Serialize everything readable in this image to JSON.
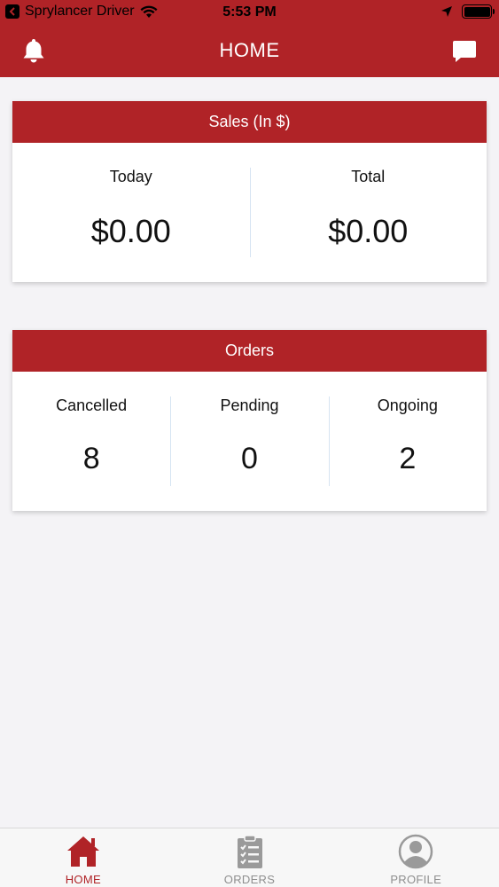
{
  "status_bar": {
    "carrier": "Sprylancer Driver",
    "time": "5:53 PM"
  },
  "header": {
    "title": "HOME",
    "left_icon": "bell-icon",
    "right_icon": "chat-icon"
  },
  "sales": {
    "title": "Sales (In $)",
    "today_label": "Today",
    "today_value": "$0.00",
    "total_label": "Total",
    "total_value": "$0.00"
  },
  "orders": {
    "title": "Orders",
    "cancelled_label": "Cancelled",
    "cancelled_value": "8",
    "pending_label": "Pending",
    "pending_value": "0",
    "ongoing_label": "Ongoing",
    "ongoing_value": "2"
  },
  "tabs": [
    {
      "label": "HOME",
      "icon": "home-icon",
      "active": true
    },
    {
      "label": "ORDERS",
      "icon": "clipboard-icon",
      "active": false
    },
    {
      "label": "PROFILE",
      "icon": "profile-icon",
      "active": false
    }
  ],
  "colors": {
    "brand": "#b02327",
    "background": "#f4f3f6",
    "inactive_tab": "#8e8e8e"
  }
}
